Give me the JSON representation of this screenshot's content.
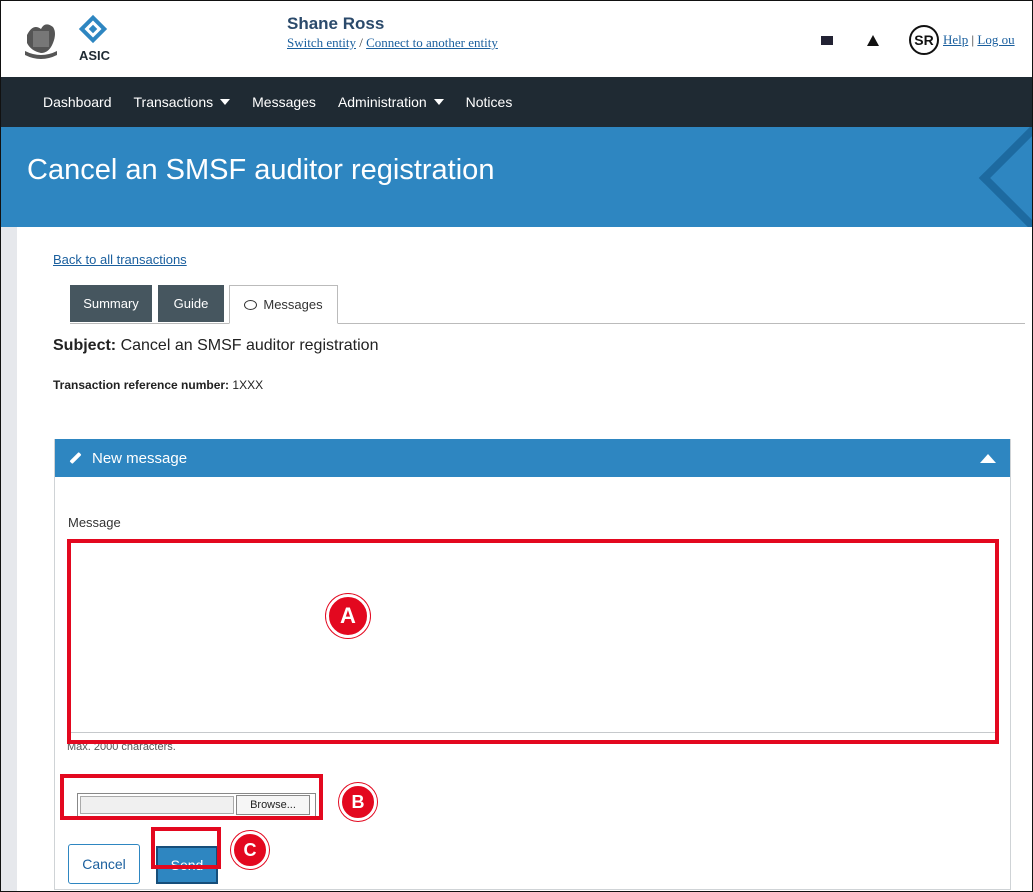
{
  "header": {
    "logo_text": "ASIC",
    "user_name": "Shane Ross",
    "switch_entity": "Switch entity",
    "separator": "/",
    "connect_entity": "Connect to another entity",
    "avatar_initials": "SR",
    "help": "Help",
    "pipe": "|",
    "logout": "Log ou"
  },
  "nav": {
    "items": [
      "Dashboard",
      "Transactions",
      "Messages",
      "Administration",
      "Notices"
    ]
  },
  "page": {
    "title": "Cancel an SMSF auditor registration",
    "back_link": "Back to all transactions",
    "tabs": [
      "Summary",
      "Guide",
      "Messages"
    ],
    "subject_label": "Subject:",
    "subject_value": "Cancel an SMSF auditor registration",
    "txref_label": "Transaction reference number:",
    "txref_value": "1XXX"
  },
  "panel": {
    "heading": "New message",
    "message_label": "Message",
    "message_value": "",
    "hint": "Max. 2000 characters.",
    "browse": "Browse...",
    "cancel": "Cancel",
    "send": "Send"
  },
  "annotations": {
    "a": "A",
    "b": "B",
    "c": "C"
  }
}
